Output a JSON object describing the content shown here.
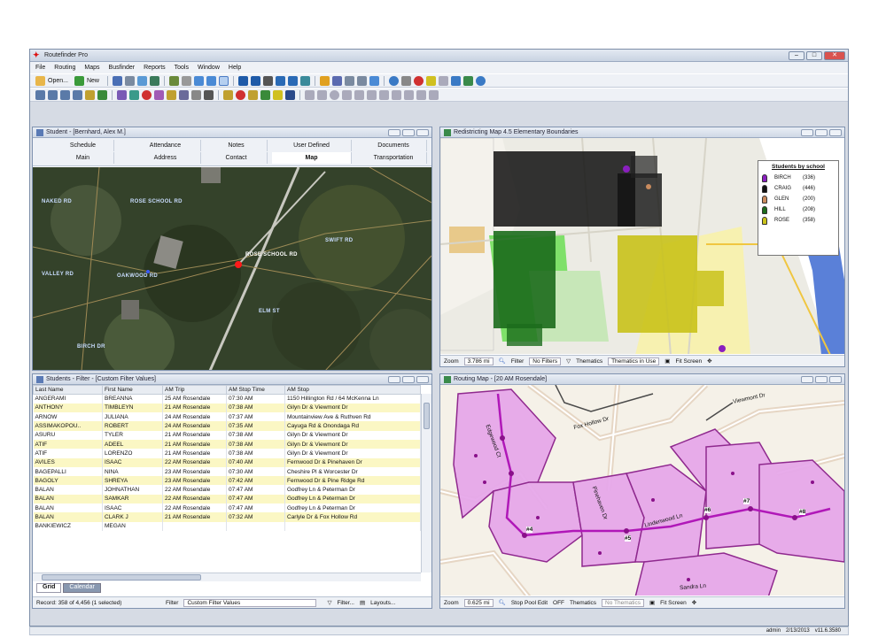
{
  "app": {
    "title": "Routefinder Pro"
  },
  "menu": [
    "File",
    "Routing",
    "Maps",
    "Busfinder",
    "Reports",
    "Tools",
    "Window",
    "Help"
  ],
  "toolbar": {
    "open_label": "Open...",
    "new_label": "New"
  },
  "student_pane": {
    "title": "Student - [Bernhard, Alex M.]",
    "tabs_row1": [
      "Schedule",
      "Attendance",
      "Notes",
      "User Defined",
      "Documents"
    ],
    "tabs_row2": [
      "Main",
      "Address",
      "Contact",
      "Map",
      "Transportation"
    ],
    "map_labels": [
      "NAKED RD",
      "ROSE SCHOOL RD",
      "ROSE SCHOOL RD",
      "SWIFT RD",
      "VALLEY RD",
      "OAKWOOD RD",
      "ELM ST",
      "BIRCH DR"
    ]
  },
  "redistricting_pane": {
    "title": "Redistricting Map 4.5 Elementary Boundaries",
    "legend": {
      "title": "Students by school",
      "items": [
        {
          "name": "BIRCH",
          "count": "(336)",
          "color": "#8a1fbf"
        },
        {
          "name": "CRAIG",
          "count": "(446)",
          "color": "#111111"
        },
        {
          "name": "GLEN",
          "count": "(200)",
          "color": "#c98b5e"
        },
        {
          "name": "HILL",
          "count": "(208)",
          "color": "#1c6b1c"
        },
        {
          "name": "ROSE",
          "count": "(358)",
          "color": "#c9c21a"
        }
      ]
    },
    "status": {
      "zoom_label": "Zoom",
      "zoom_value": "3.786 mi",
      "filter_label": "Filter",
      "filter_value": "No Filters",
      "thematics_label": "Thematics",
      "thematics_value": "Thematics in Use",
      "fit_label": "Fit Screen"
    }
  },
  "students_grid": {
    "title": "Students - Filter - [Custom Filter Values]",
    "columns": [
      "Last Name",
      "First Name",
      "AM Trip",
      "AM Stop Time",
      "AM Stop"
    ],
    "rows": [
      [
        "ANGERAMI",
        "BREANNA",
        "25 AM Rosendale",
        "07:30 AM",
        "1150 Hillington Rd / 64 McKenna Ln"
      ],
      [
        "ANTHONY",
        "TIMBLEYN",
        "21 AM Rosendale",
        "07:38 AM",
        "Gilyn Dr & Viewmont Dr"
      ],
      [
        "ARNOW",
        "JULIANA",
        "24 AM Rosendale",
        "07:37 AM",
        "Mountainview Ave & Ruthven Rd"
      ],
      [
        "ASSIMAKOPOU..",
        "ROBERT",
        "24 AM Rosendale",
        "07:35 AM",
        "Cayuga Rd & Onondaga Rd"
      ],
      [
        "ASURU",
        "TYLER",
        "21 AM Rosendale",
        "07:38 AM",
        "Gilyn Dr & Viewmont Dr"
      ],
      [
        "ATIF",
        "ADEEL",
        "21 AM Rosendale",
        "07:38 AM",
        "Gilyn Dr & Viewmont Dr"
      ],
      [
        "ATIF",
        "LORENZO",
        "21 AM Rosendale",
        "07:38 AM",
        "Gilyn Dr & Viewmont Dr"
      ],
      [
        "AVILES",
        "ISAAC",
        "22 AM Rosendale",
        "07:40 AM",
        "Fernwood Dr & Pinehaven Dr"
      ],
      [
        "BAGEPALLI",
        "NINA",
        "23 AM Rosendale",
        "07:30 AM",
        "Cheshire Pl & Worcester Dr"
      ],
      [
        "BAGOLY",
        "SHREYA",
        "23 AM Rosendale",
        "07:42 AM",
        "Fernwood Dr & Pine Ridge Rd"
      ],
      [
        "BALAN",
        "JOHNATHAN",
        "22 AM Rosendale",
        "07:47 AM",
        "Godfrey Ln & Peterman Dr"
      ],
      [
        "BALAN",
        "SAMKAR",
        "22 AM Rosendale",
        "07:47 AM",
        "Godfrey Ln & Peterman Dr"
      ],
      [
        "BALAN",
        "ISAAC",
        "22 AM Rosendale",
        "07:47 AM",
        "Godfrey Ln & Peterman Dr"
      ],
      [
        "BALAN",
        "CLARK J",
        "21 AM Rosendale",
        "07:32 AM",
        "Carlyle Dr & Fox Hollow Rd"
      ],
      [
        "BANKIEWICZ",
        "MEGAN",
        "",
        "",
        ""
      ]
    ],
    "tabs": [
      "Grid",
      "Calendar"
    ],
    "status": {
      "record": "Record: 358 of 4,456 (1 selected)",
      "filter_label": "Filter",
      "filter_value": "Custom Filter Values",
      "filter_btn": "Filter...",
      "layouts_btn": "Layouts..."
    }
  },
  "routing_pane": {
    "title": "Routing Map - [20 AM Rosendale]",
    "street_labels": [
      "Viewmont Dr",
      "Fox Hollow Dr",
      "Edgewood Ct",
      "Pinehaven Dr",
      "Lindenwood Ln",
      "Sandra Ln"
    ],
    "stops": [
      "#4",
      "#5",
      "#6",
      "#7",
      "#8"
    ],
    "status": {
      "zoom_label": "Zoom",
      "zoom_value": "0.625 mi",
      "stop_edit": "Stop Pool Edit",
      "stop_edit_value": "OFF",
      "thematics_label": "Thematics",
      "thematics_value": "No Thematics",
      "fit_label": "Fit Screen"
    }
  },
  "statusbar": {
    "user": "admin",
    "date": "2/13/2013",
    "version": "v11.6.3580"
  }
}
